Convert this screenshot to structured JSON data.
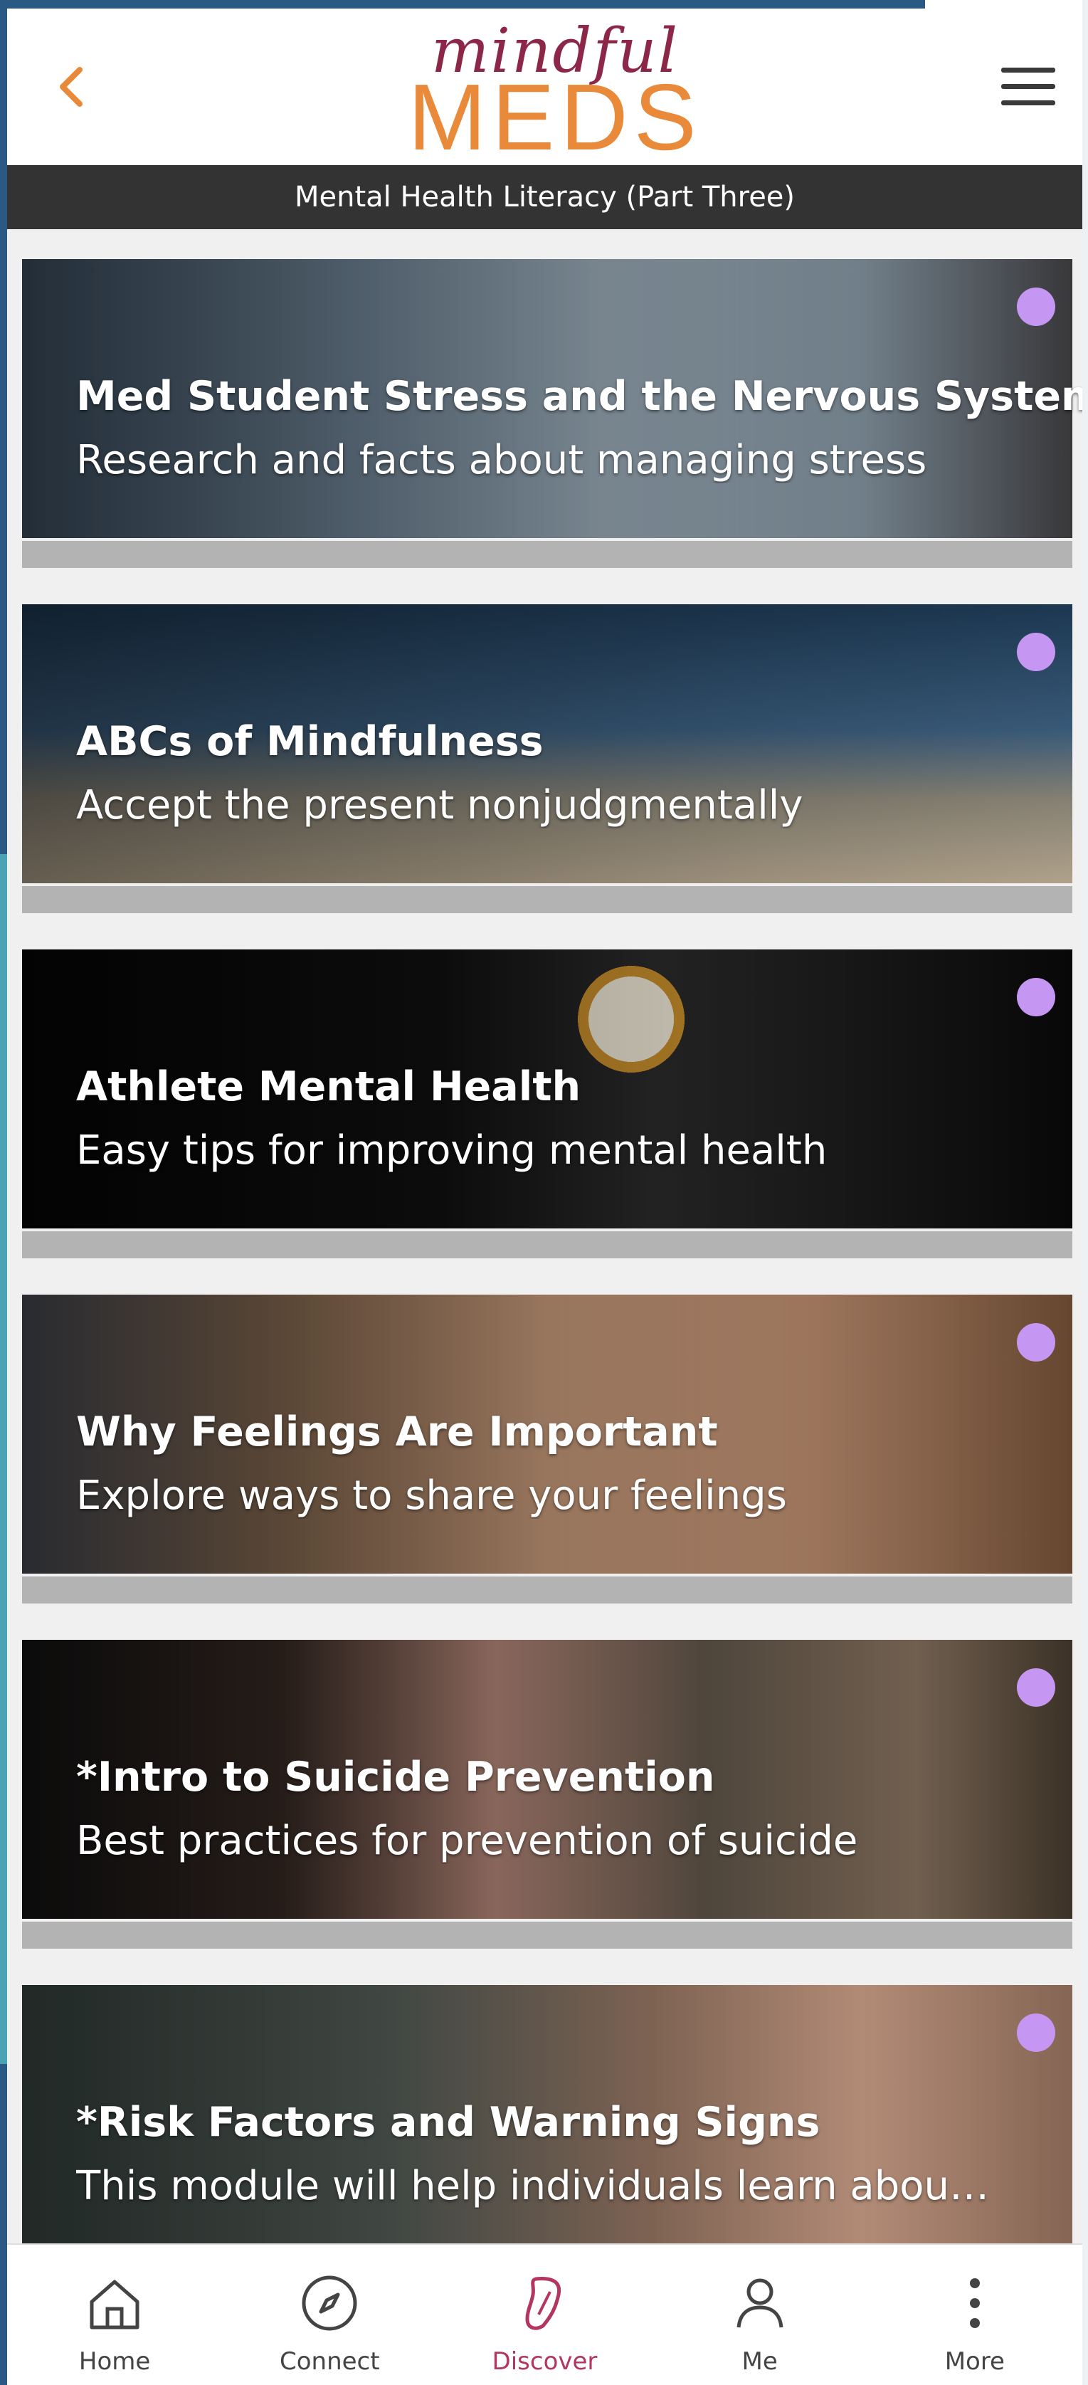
{
  "header": {
    "logo_script": "mindful",
    "logo_meds": "MEDS",
    "back_icon": "chevron-left-icon",
    "menu_icon": "hamburger-menu-icon"
  },
  "subheader": {
    "title": "Mental Health Literacy (Part Three)"
  },
  "colors": {
    "back_accent": "#e98a3a",
    "logo_script": "#8c2748",
    "logo_meds": "#e98a3a",
    "subbar_bg": "#333333",
    "unread_dot": "#c597f2",
    "track": "#b3b3b3",
    "nav_active": "#b3365f"
  },
  "modules": [
    {
      "title": "Med Student Stress and the Nervous System*",
      "subtitle": "Research and facts about managing stress"
    },
    {
      "title": "ABCs of Mindfulness",
      "subtitle": "Accept the present nonjudgmentally"
    },
    {
      "title": "Athlete Mental Health",
      "subtitle": "Easy tips for improving mental health"
    },
    {
      "title": "Why Feelings Are Important",
      "subtitle": "Explore ways to share your feelings"
    },
    {
      "title": "*Intro to Suicide Prevention",
      "subtitle": "Best practices for prevention of suicide"
    },
    {
      "title": "*Risk Factors and Warning Signs",
      "subtitle": "This module will help individuals learn abou…"
    }
  ],
  "bottom_nav": [
    {
      "label": "Home",
      "icon": "home-icon",
      "active": false
    },
    {
      "label": "Connect",
      "icon": "compass-icon",
      "active": false
    },
    {
      "label": "Discover",
      "icon": "discover-icon",
      "active": true
    },
    {
      "label": "Me",
      "icon": "user-icon",
      "active": false
    },
    {
      "label": "More",
      "icon": "more-vertical-icon",
      "active": false
    }
  ]
}
